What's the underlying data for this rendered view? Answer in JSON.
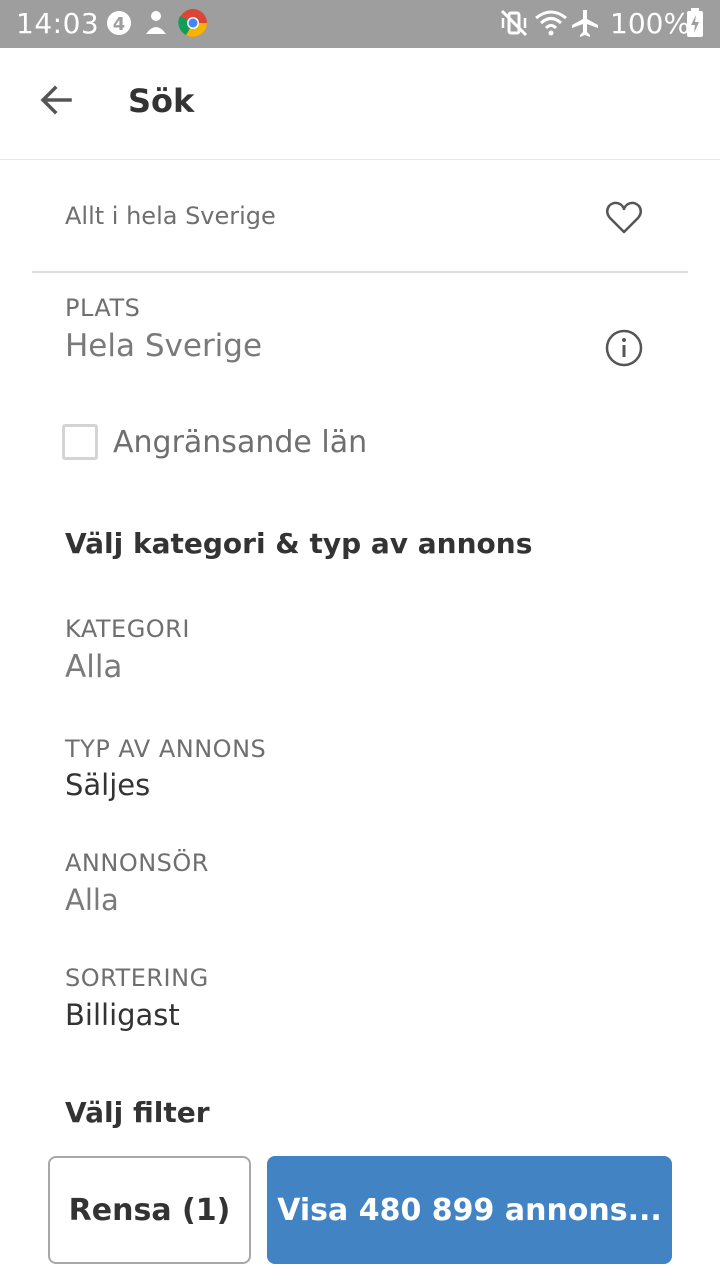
{
  "status_bar": {
    "time": "14:03",
    "notification_badge": "4",
    "battery_text": "100%",
    "icons": [
      "alarm-badge-icon",
      "anonymous-icon",
      "chrome-icon",
      "vibrate-icon",
      "wifi-icon",
      "airplane-icon",
      "battery-charging-icon"
    ]
  },
  "app_bar": {
    "back_icon": "arrow-left-icon",
    "title": "Sök"
  },
  "saved_search": {
    "text": "Allt i hela Sverige",
    "icon": "heart-outline-icon"
  },
  "location": {
    "label": "PLATS",
    "value": "Hela Sverige",
    "info_icon": "info-circle-icon"
  },
  "adjacent_counties": {
    "label": "Angränsande län",
    "checked": false
  },
  "category_section": {
    "title": "Välj kategori & typ av annons",
    "fields": [
      {
        "label": "KATEGORI",
        "value": "Alla"
      },
      {
        "label": "TYP AV ANNONS",
        "value": "Säljes"
      },
      {
        "label": "ANNONSÖR",
        "value": "Alla"
      },
      {
        "label": "SORTERING",
        "value": "Billigast"
      }
    ]
  },
  "filter_section": {
    "title": "Välj filter"
  },
  "actions": {
    "clear_label": "Rensa (1)",
    "show_label": "Visa 480 899 annons..."
  },
  "colors": {
    "status_bar": "#9e9e9e",
    "primary_button": "#4283c4",
    "text_dark": "#333333",
    "text_muted": "#6f6f6f"
  }
}
